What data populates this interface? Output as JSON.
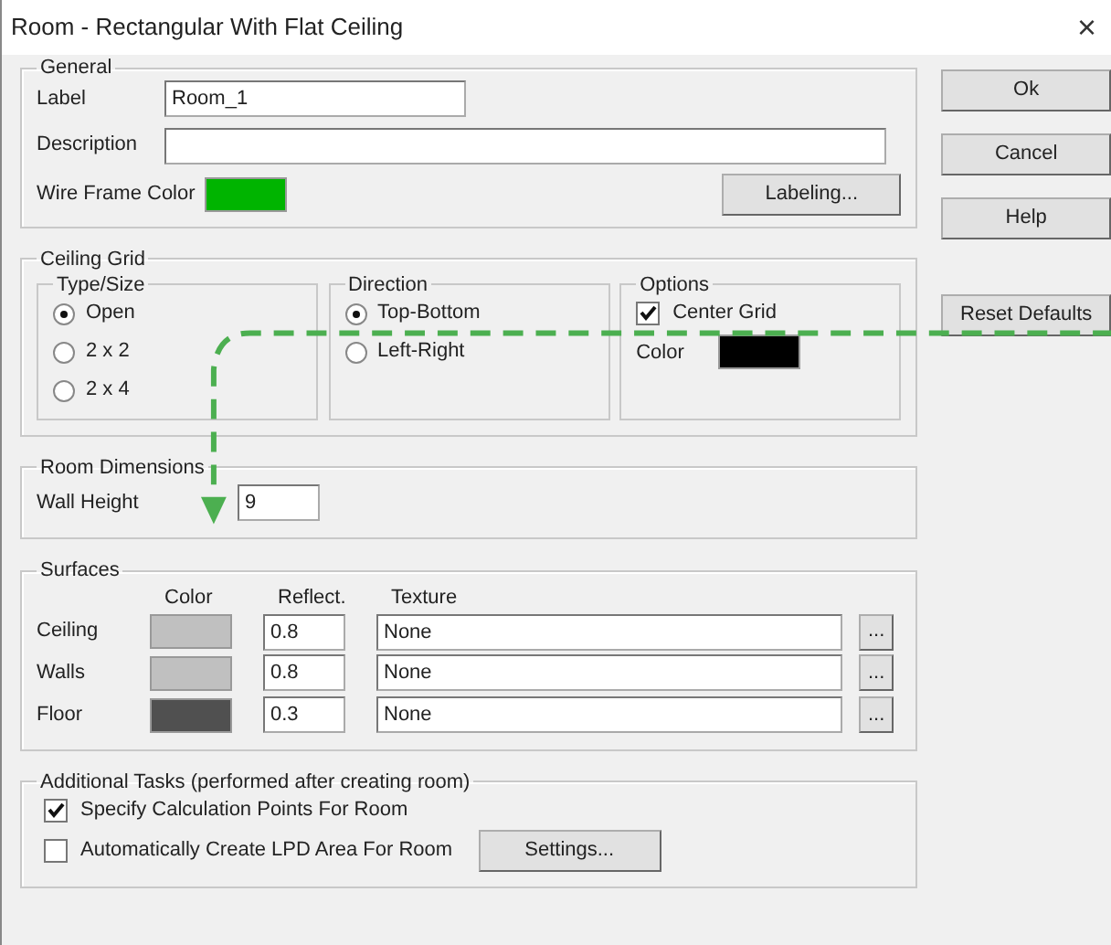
{
  "window": {
    "title": "Room - Rectangular With Flat Ceiling",
    "close": "×"
  },
  "general": {
    "title": "General",
    "label_field": {
      "label": "Label",
      "value": "Room_1"
    },
    "description_field": {
      "label": "Description"
    },
    "wire_frame_color": {
      "label": "Wire Frame Color",
      "color": "#00b400"
    },
    "labeling_button": "Labeling..."
  },
  "ceiling_grid": {
    "title": "Ceiling Grid",
    "type_size": {
      "title": "Type/Size",
      "options": [
        {
          "label": "Open",
          "selected": true
        },
        {
          "label": "2 x 2",
          "selected": false
        },
        {
          "label": "2 x 4",
          "selected": false
        }
      ]
    },
    "direction": {
      "title": "Direction",
      "options": [
        {
          "label": "Top-Bottom",
          "selected": true
        },
        {
          "label": "Left-Right",
          "selected": false
        }
      ]
    },
    "options": {
      "title": "Options",
      "center_grid": {
        "label": "Center Grid",
        "checked": true
      },
      "color": {
        "label": "Color",
        "color": "#000000"
      }
    }
  },
  "room_dimensions": {
    "title": "Room Dimensions",
    "wall_height": {
      "label": "Wall Height",
      "value": "9"
    }
  },
  "surfaces": {
    "title": "Surfaces",
    "columns": [
      "Color",
      "Reflect.",
      "Texture"
    ],
    "rows": [
      {
        "name": "Ceiling",
        "color": "#c0c0c0",
        "reflect": "0.8",
        "texture": "None",
        "browse": "..."
      },
      {
        "name": "Walls",
        "color": "#c0c0c0",
        "reflect": "0.8",
        "texture": "None",
        "browse": "..."
      },
      {
        "name": "Floor",
        "color": "#505050",
        "reflect": "0.3",
        "texture": "None",
        "browse": "..."
      }
    ]
  },
  "additional_tasks": {
    "title": "Additional Tasks (performed after creating room)",
    "items": [
      {
        "label": "Specify Calculation Points For Room",
        "checked": true
      },
      {
        "label": "Automatically Create LPD Area For Room",
        "checked": false,
        "button": "Settings..."
      }
    ]
  },
  "buttons": [
    "Ok",
    "Cancel",
    "Help"
  ],
  "reset_button": "Reset Defaults"
}
